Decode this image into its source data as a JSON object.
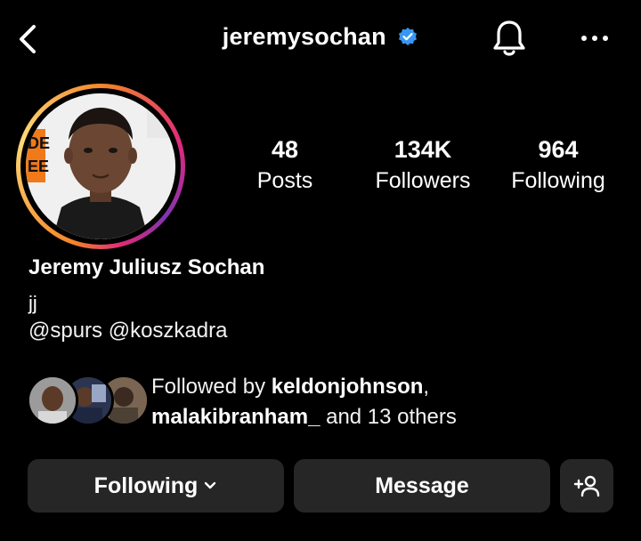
{
  "header": {
    "back_icon": "chevron-left-icon",
    "username": "jeremysochan",
    "verified_icon": "verified-badge-icon",
    "bell_icon": "bell-icon",
    "more_icon": "more-horizontal-icon"
  },
  "stats": {
    "posts": {
      "value": "48",
      "label": "Posts"
    },
    "followers": {
      "value": "134K",
      "label": "Followers"
    },
    "following": {
      "value": "964",
      "label": "Following"
    }
  },
  "profile": {
    "full_name": "Jeremy Juliusz Sochan",
    "bio": "jj",
    "mentions": "@spurs @koszkadra"
  },
  "followed_by": {
    "prefix": "Followed by ",
    "user1": "keldonjohnson",
    "comma": ",",
    "user2": "malakibranham_",
    "suffix": " and 13 others"
  },
  "actions": {
    "following_label": "Following",
    "message_label": "Message",
    "add_person_icon": "add-person-icon"
  },
  "colors": {
    "background": "#000000",
    "button": "#262626",
    "verified": "#3897f0"
  }
}
